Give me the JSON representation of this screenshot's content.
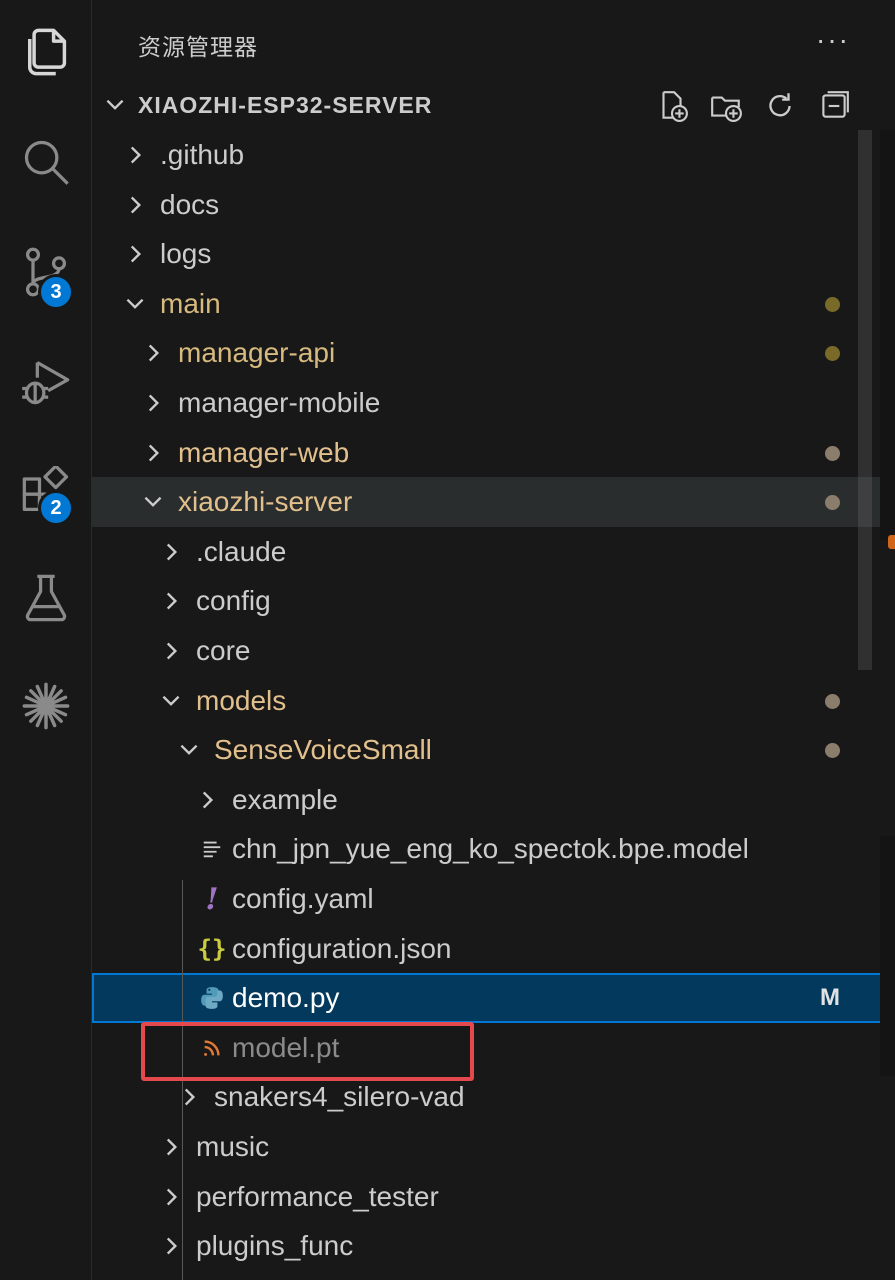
{
  "activity_bar": {
    "items": [
      {
        "name": "explorer-icon",
        "badge": ""
      },
      {
        "name": "search-icon",
        "badge": ""
      },
      {
        "name": "source-control-icon",
        "badge": "3"
      },
      {
        "name": "run-debug-icon",
        "badge": ""
      },
      {
        "name": "extensions-icon",
        "badge": "2"
      },
      {
        "name": "testing-icon",
        "badge": ""
      },
      {
        "name": "claude-icon",
        "badge": ""
      }
    ]
  },
  "sidebar": {
    "title": "资源管理器",
    "more": "···",
    "section_title": "XIAOZHI-ESP32-SERVER"
  },
  "tree": [
    {
      "label": ".github",
      "type": "folder",
      "expanded": false,
      "status": "none"
    },
    {
      "label": "docs",
      "type": "folder",
      "expanded": false,
      "status": "none"
    },
    {
      "label": "logs",
      "type": "folder",
      "expanded": false,
      "status": "none"
    },
    {
      "label": "main",
      "type": "folder",
      "expanded": true,
      "status": "dot-gold"
    },
    {
      "label": "manager-api",
      "type": "folder",
      "expanded": false,
      "status": "dot-gold"
    },
    {
      "label": "manager-mobile",
      "type": "folder",
      "expanded": false,
      "status": "none"
    },
    {
      "label": "manager-web",
      "type": "folder",
      "expanded": false,
      "status": "dot"
    },
    {
      "label": "xiaozhi-server",
      "type": "folder",
      "expanded": true,
      "status": "dot"
    },
    {
      "label": ".claude",
      "type": "folder",
      "expanded": false,
      "status": "none"
    },
    {
      "label": "config",
      "type": "folder",
      "expanded": false,
      "status": "none"
    },
    {
      "label": "core",
      "type": "folder",
      "expanded": false,
      "status": "none"
    },
    {
      "label": "models",
      "type": "folder",
      "expanded": true,
      "status": "dot"
    },
    {
      "label": "SenseVoiceSmall",
      "type": "folder",
      "expanded": true,
      "status": "dot"
    },
    {
      "label": "example",
      "type": "folder",
      "expanded": false,
      "status": "none"
    },
    {
      "label": "chn_jpn_yue_eng_ko_spectok.bpe.model",
      "type": "file",
      "icon": "lines-icon",
      "status": "none"
    },
    {
      "label": "config.yaml",
      "type": "file",
      "icon": "exclamation-icon",
      "status": "none"
    },
    {
      "label": "configuration.json",
      "type": "file",
      "icon": "braces-icon",
      "status": "none"
    },
    {
      "label": "demo.py",
      "type": "file",
      "icon": "python-icon",
      "status": "M"
    },
    {
      "label": "model.pt",
      "type": "file",
      "icon": "rss-icon",
      "status": "ignored"
    },
    {
      "label": "snakers4_silero-vad",
      "type": "folder",
      "expanded": false,
      "status": "none"
    },
    {
      "label": "music",
      "type": "folder",
      "expanded": false,
      "status": "none"
    },
    {
      "label": "performance_tester",
      "type": "folder",
      "expanded": false,
      "status": "none"
    },
    {
      "label": "plugins_func",
      "type": "folder",
      "expanded": false,
      "status": "none"
    }
  ],
  "colors": {
    "accent": "#0078d4",
    "modified_dot": "#8b7d6b",
    "gold_dot": "#7a6a2a",
    "highlight": "#e5484d"
  }
}
